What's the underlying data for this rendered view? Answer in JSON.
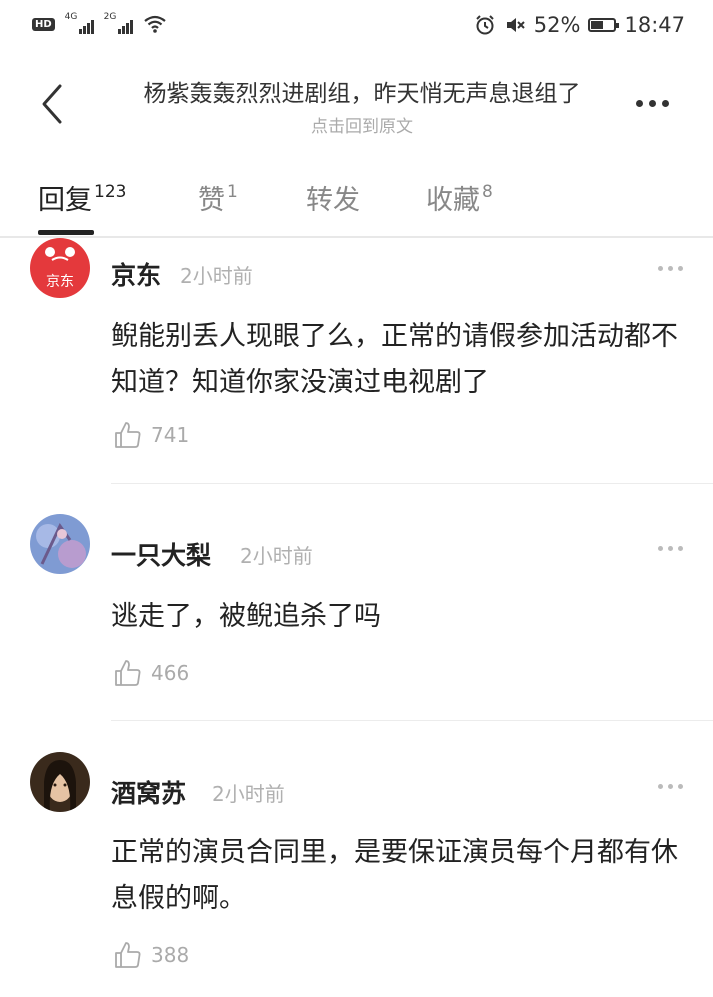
{
  "status_bar": {
    "hd": "HD",
    "net1": "4G",
    "net2": "2G",
    "battery_pct": "52%",
    "battery_level": 0.52,
    "time": "18:47"
  },
  "header": {
    "title": "杨紫轰轰烈烈进剧组，昨天悄无声息退组了",
    "subtitle": "点击回到原文"
  },
  "tabs": [
    {
      "label": "回复",
      "count": "123"
    },
    {
      "label": "赞",
      "count": "1"
    },
    {
      "label": "转发",
      "count": ""
    },
    {
      "label": "收藏",
      "count": "8"
    }
  ],
  "comments": [
    {
      "name": "京东",
      "time": "2小时前",
      "text": "鲵能别丢人现眼了么，正常的请假参加活动都不知道？知道你家没演过电视剧了",
      "likes": "741",
      "avatar_text": "京东"
    },
    {
      "name": "一只大梨",
      "time": "2小时前",
      "text": "逃走了，被鲵追杀了吗",
      "likes": "466"
    },
    {
      "name": "酒窝苏",
      "time": "2小时前",
      "text": "正常的演员合同里，是要保证演员每个月都有休息假的啊。",
      "likes": "388"
    }
  ],
  "colors": {
    "jd_red": "#e4393c",
    "divider": "#ececec",
    "muted_text": "#b0b0b0"
  }
}
